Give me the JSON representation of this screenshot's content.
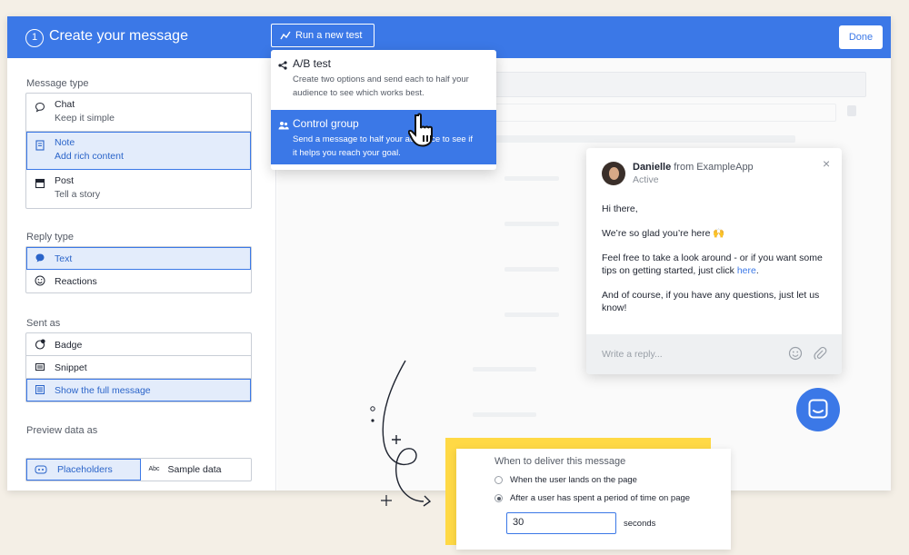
{
  "header": {
    "step_number": "1",
    "title": "Create your message",
    "run_test_label": "Run a new test",
    "done_label": "Done"
  },
  "dropdown": {
    "items": [
      {
        "title": "A/B test",
        "description": "Create two options and send each to half your audience to see which works best."
      },
      {
        "title": "Control group",
        "description": "Send a message to half your audience to see if it helps you reach your goal."
      }
    ]
  },
  "message_type": {
    "label": "Message type",
    "options": [
      {
        "title": "Chat",
        "subtitle": "Keep it simple"
      },
      {
        "title": "Note",
        "subtitle": "Add rich content"
      },
      {
        "title": "Post",
        "subtitle": "Tell a story"
      }
    ]
  },
  "reply_type": {
    "label": "Reply type",
    "options": [
      {
        "title": "Text"
      },
      {
        "title": "Reactions"
      }
    ]
  },
  "sent_as": {
    "label": "Sent as",
    "options": [
      {
        "title": "Badge"
      },
      {
        "title": "Snippet"
      },
      {
        "title": "Show the full message"
      }
    ]
  },
  "preview_data": {
    "label": "Preview data as",
    "options": [
      {
        "title": "Placeholders"
      },
      {
        "title": "Sample data",
        "icon_text": "Abc"
      }
    ]
  },
  "messenger": {
    "sender_name": "Danielle",
    "sender_from": "from ExampleApp",
    "status": "Active",
    "greeting": "Hi there,",
    "line1": "We’re so glad you’re here 🙌",
    "line2_before": "Feel free to take a look around - or if you want some tips on getting started, just click ",
    "line2_link": "here",
    "line2_after": ".",
    "line3": "And of course, if you have any questions, just let us know!",
    "reply_placeholder": "Write a reply..."
  },
  "delivery": {
    "title": "When to deliver this message",
    "options": [
      {
        "label": "When the user lands on the page",
        "selected": false
      },
      {
        "label": "After a user has spent a period of time on page",
        "selected": true
      }
    ],
    "value": "30",
    "unit": "seconds"
  },
  "colors": {
    "accent": "#3b78e7",
    "highlight": "#ffd945",
    "background": "#f4efe6"
  }
}
